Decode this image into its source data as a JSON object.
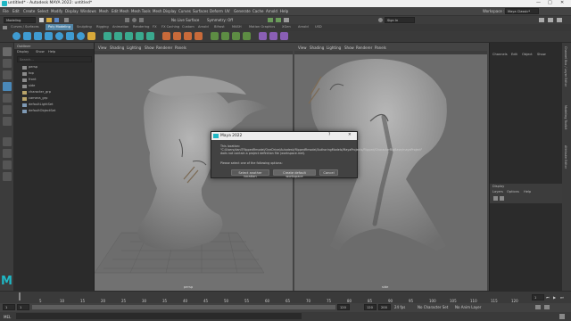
{
  "window": {
    "title": "untitled* - Autodesk MAYA 2022: untitled*"
  },
  "menubar": {
    "items": [
      "File",
      "Edit",
      "Create",
      "Select",
      "Modify",
      "Display",
      "Windows",
      "Mesh",
      "Edit Mesh",
      "Mesh Tools",
      "Mesh Display",
      "Curves",
      "Surfaces",
      "Deform",
      "UV",
      "Generate",
      "Cache",
      "Arnold",
      "Help"
    ],
    "workspace_label": "Workspace :",
    "workspace_value": "Maya Classic*"
  },
  "statusline": {
    "menuset": "Modeling",
    "no_live_surface": "No Live Surface",
    "symmetry": "Symmetry: Off",
    "sign_in": "Sign In"
  },
  "shelf": {
    "tabs": [
      "Curves / Surfaces",
      "Poly Modeling",
      "Sculpting",
      "Rigging",
      "Animation",
      "Rendering",
      "FX",
      "FX Caching",
      "Custom",
      "Arnold",
      "Bifrost",
      "MASH",
      "Motion Graphics",
      "XGen",
      "Arnold",
      "USD"
    ],
    "active_tab": "Poly Modeling"
  },
  "outliner": {
    "title": "Outliner",
    "menus": [
      "Display",
      "Show",
      "Help"
    ],
    "search_placeholder": "Search...",
    "items": [
      "persp",
      "top",
      "front",
      "side",
      "character_grp",
      "camera_grp",
      "defaultLightSet",
      "defaultObjectSet"
    ]
  },
  "viewports": [
    {
      "menus": [
        "View",
        "Shading",
        "Lighting",
        "Show",
        "Renderer",
        "Panels"
      ],
      "camera_label": "persp"
    },
    {
      "menus": [
        "View",
        "Shading",
        "Lighting",
        "Show",
        "Renderer",
        "Panels"
      ],
      "camera_label": "side"
    }
  ],
  "channelbox": {
    "menus": [
      "Channels",
      "Edit",
      "Object",
      "Show"
    ],
    "display_tab": "Display",
    "display_menus": [
      "Layers",
      "Options",
      "Help"
    ]
  },
  "sidebar": {
    "tabs": [
      "Channel Box / Layer Editor",
      "Modeling Toolkit",
      "Attribute Editor"
    ]
  },
  "timeline": {
    "ticks": [
      "5",
      "10",
      "15",
      "20",
      "25",
      "30",
      "35",
      "40",
      "45",
      "50",
      "55",
      "60",
      "65",
      "70",
      "75",
      "80",
      "85",
      "90",
      "95",
      "100",
      "105",
      "110",
      "115",
      "120"
    ],
    "current_frame": "1"
  },
  "range": {
    "start": "1",
    "start_inner": "1",
    "end_inner": "120",
    "end": "120",
    "end2": "200",
    "fps": "24 fps",
    "char_set": "No Character Set",
    "anim_layer": "No Anim Layer"
  },
  "cmdline": {
    "lang": "MEL"
  },
  "dialog": {
    "title": "Maya 2022",
    "message": "This location: \"C:/Users/daniTflippedRmodel/OneDrive/Autodesk/flippedRmodel/AuthoringModels/MayaProjects/Flipped/CharacterRigBase/mayaProject\" does not contain a project definition file (workspace.mel).",
    "prompt": "Please select one of the following options:",
    "buttons": [
      "Select another location",
      "Create default workspace",
      "Cancel"
    ]
  },
  "colors": {
    "viewport_bg": "#717171",
    "maya_logo": "#1fb7c4",
    "active_tab": "#5285a6"
  }
}
